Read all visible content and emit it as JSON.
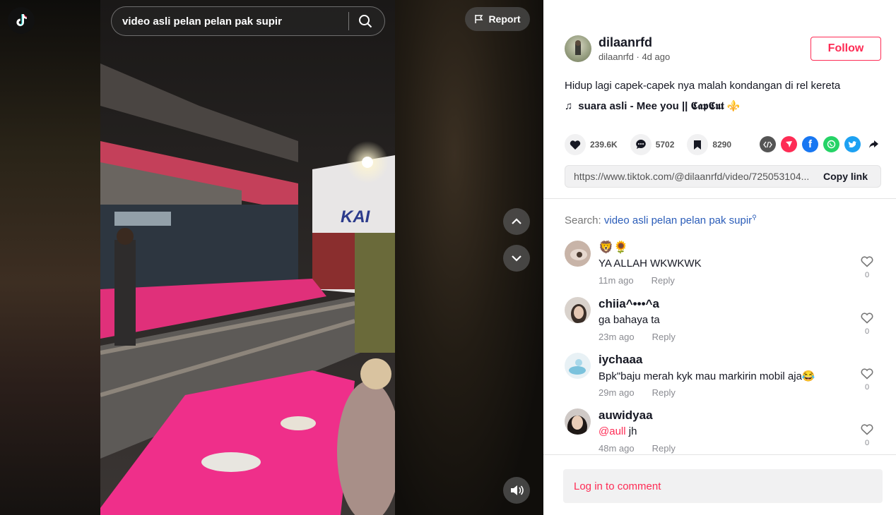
{
  "search": {
    "value": "video asli pelan pelan pak supir"
  },
  "report_label": "Report",
  "author": {
    "username": "dilaanrfd",
    "handle": "dilaanrfd",
    "time": "4d ago"
  },
  "follow_label": "Follow",
  "caption": "Hidup lagi capek-capek nya malah kondangan di rel kereta",
  "music": "suara asli - Mee you || 𝕮𝖆𝖕𝕮𝖚𝖙 ⚜️",
  "stats": {
    "likes": "239.6K",
    "comments": "5702",
    "saves": "8290"
  },
  "share_icons": [
    "embed-icon",
    "send-icon",
    "facebook-icon",
    "whatsapp-icon",
    "twitter-icon",
    "share-arrow-icon"
  ],
  "link": {
    "url": "https://www.tiktok.com/@dilaanrfd/video/725053104...",
    "copy_label": "Copy link"
  },
  "related_search": {
    "label": "Search:",
    "query": "video asli pelan pelan pak supir"
  },
  "comments": [
    {
      "name": "🦁🌻",
      "text": "YA ALLAH WKWKWK",
      "time": "11m ago",
      "reply": "Reply",
      "likes": "0"
    },
    {
      "name": "chiia^•••^a",
      "text": "ga bahaya ta",
      "time": "23m ago",
      "reply": "Reply",
      "likes": "0"
    },
    {
      "name": "iychaaa",
      "text": "Bpk\"baju merah kyk mau markirin mobil aja😂",
      "time": "29m ago",
      "reply": "Reply",
      "likes": "0"
    },
    {
      "name": "auwidyaa",
      "mention": "@aull",
      "text": " jh",
      "time": "48m ago",
      "reply": "Reply",
      "likes": "0"
    }
  ],
  "login_label": "Log in to comment",
  "colors": {
    "accent": "#fe2c55",
    "link_blue": "#2b5db9"
  }
}
